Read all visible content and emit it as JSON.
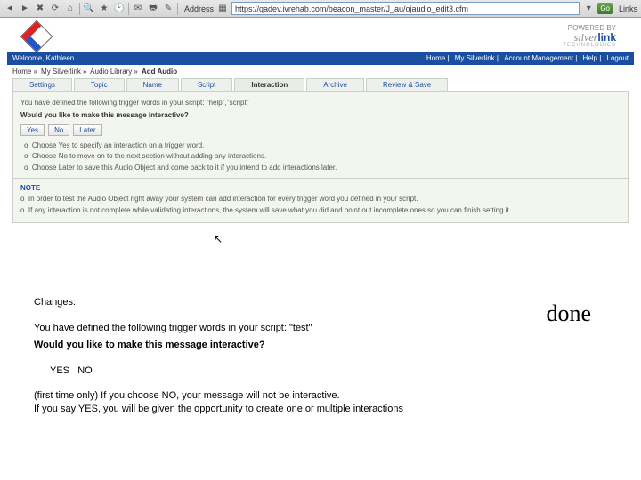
{
  "toolbar": {
    "address_label": "Address",
    "url": "https://qadev.ivrehab.com/beacon_master/J_au/ojaudio_edit3.cfm",
    "go_label": "Go",
    "links_label": "Links"
  },
  "header": {
    "powered_by": "POWERED  BY",
    "brand_italic": "silver",
    "brand_bold": "link",
    "brand_sub": "TECHNOLOGIES"
  },
  "bluebar": {
    "welcome": "Welcome, Kathleen",
    "nav": [
      "Home",
      "My Silverlink",
      "Account Management",
      "Help",
      "Logout"
    ]
  },
  "crumbs": {
    "items": [
      "Home",
      "My Silverlink",
      "Audio Library"
    ],
    "current": "Add Audio"
  },
  "tabs": [
    "Settings",
    "Topic",
    "Name",
    "Script",
    "Interaction",
    "Archive",
    "Review & Save"
  ],
  "panel": {
    "line_defined": "You have defined the following trigger words in your script: \"help\",\"script\"",
    "line_question": "Would you like to make this message interactive?",
    "buttons": {
      "yes": "Yes",
      "no": "No",
      "later": "Later"
    },
    "bullets": [
      "Choose Yes to specify an interaction on a trigger word.",
      "Choose No to move on to the next section without adding any interactions.",
      "Choose Later to save this Audio Object and come back to it if you intend to add interactions later."
    ],
    "note_label": "NOTE",
    "note_lines": [
      "In order to test the Audio Object right away your system can add interaction for every trigger word you defined in your script.",
      "If any interaction is not complete while validating interactions, the system will save what you did and point out incomplete ones so you can finish setting it."
    ]
  },
  "changes": {
    "header": "Changes:",
    "p1a": "You have defined the following trigger words in your script: \"test\"",
    "p1b": "Would you like to make this message interactive?",
    "yes": "YES",
    "no": "NO",
    "p2a": "(first time only) If you choose NO, your message will not be interactive.",
    "p2b": "If you say YES, you will be given the opportunity to create one or multiple interactions"
  },
  "done": "done"
}
